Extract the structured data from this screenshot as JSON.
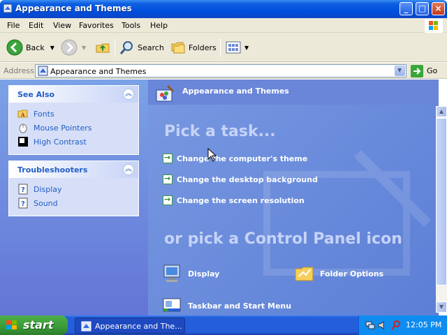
{
  "window": {
    "title": "Appearance and Themes"
  },
  "menu": [
    "File",
    "Edit",
    "View",
    "Favorites",
    "Tools",
    "Help"
  ],
  "toolbar": {
    "back_label": "Back",
    "search_label": "Search",
    "folders_label": "Folders"
  },
  "address": {
    "label": "Address",
    "value": "Appearance and Themes",
    "go_label": "Go"
  },
  "see_also": {
    "title": "See Also",
    "items": [
      {
        "label": "Fonts",
        "icon": "folder-icon"
      },
      {
        "label": "Mouse Pointers",
        "icon": "mouse-icon"
      },
      {
        "label": "High Contrast",
        "icon": "contrast-icon"
      }
    ]
  },
  "troubleshooters": {
    "title": "Troubleshooters",
    "items": [
      {
        "label": "Display",
        "icon": "help-icon"
      },
      {
        "label": "Sound",
        "icon": "help-icon"
      }
    ]
  },
  "category": {
    "title": "Appearance and Themes",
    "pick_task": "Pick a task...",
    "tasks": [
      "Change the computer's theme",
      "Change the desktop background",
      "Change the screen resolution"
    ],
    "pick_icon": "or pick a Control Panel icon",
    "icons": [
      {
        "label": "Display",
        "icon": "display-icon"
      },
      {
        "label": "Folder Options",
        "icon": "folder-options-icon"
      },
      {
        "label": "Taskbar and Start Menu",
        "icon": "taskbar-icon"
      }
    ]
  },
  "taskbar": {
    "start_label": "start",
    "task_label": "Appearance and The...",
    "time": "12:05 PM"
  },
  "colors": {
    "titlebar": "#0050df",
    "left_pane": "#7ba2e7",
    "right_pane": "#6f8edb",
    "link_blue": "#215dc6",
    "start_green": "#3a9a38"
  }
}
